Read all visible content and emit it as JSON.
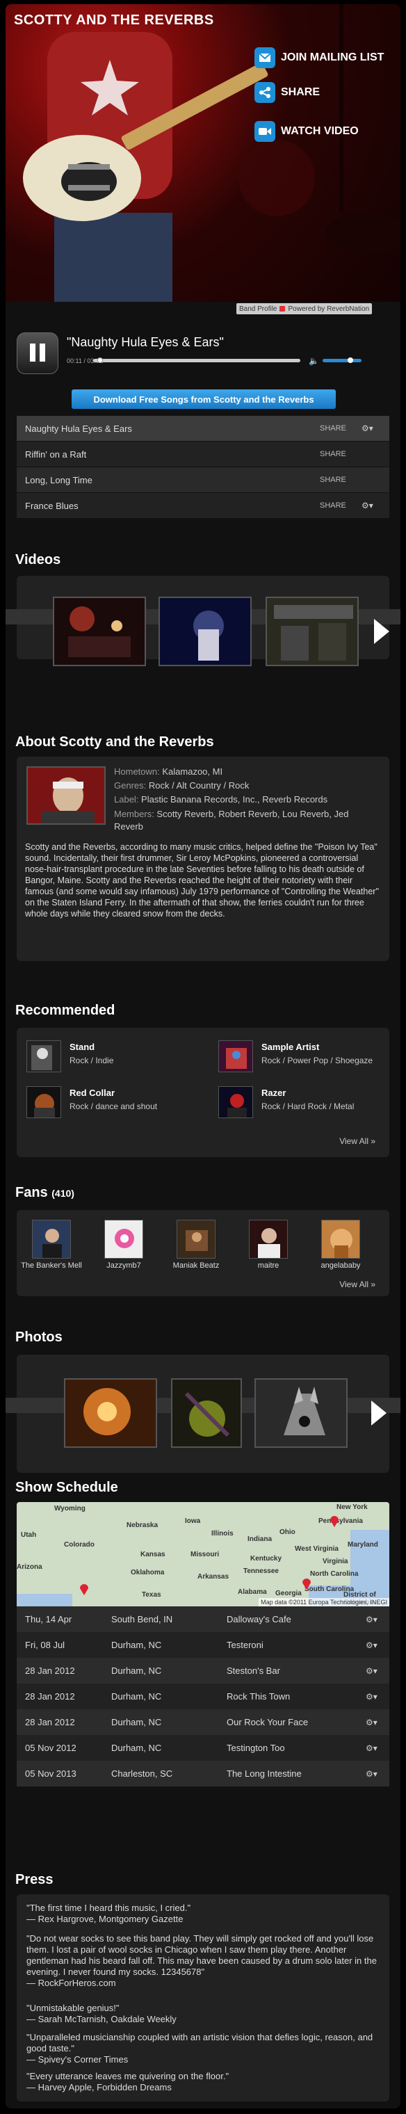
{
  "header": {
    "band_name": "SCOTTY AND THE REVERBS",
    "actions": [
      {
        "label": "JOIN MAILING LIST",
        "icon": "mail-icon"
      },
      {
        "label": "SHARE",
        "icon": "share-icon"
      },
      {
        "label": "WATCH VIDEO",
        "icon": "video-icon"
      }
    ],
    "credit": {
      "profile": "Band Profile",
      "powered": "Powered by ReverbNation"
    }
  },
  "player": {
    "now_playing": "\"Naughty Hula Eyes & Ears\"",
    "time": "00:11 / 03:02",
    "progress": 0.02,
    "volume": 0.75
  },
  "download_button": "Download Free Songs from Scotty and the Reverbs",
  "tracks": [
    {
      "title": "Naughty Hula Eyes & Ears",
      "share": "SHARE",
      "gear": "⚙▾"
    },
    {
      "title": "Riffin' on a Raft",
      "share": "SHARE",
      "gear": ""
    },
    {
      "title": "Long, Long Time",
      "share": "SHARE",
      "gear": ""
    },
    {
      "title": "France Blues",
      "share": "SHARE",
      "gear": "⚙▾"
    }
  ],
  "videos": {
    "heading": "Videos"
  },
  "about": {
    "heading": "About Scotty and the Reverbs",
    "hometown_label": "Hometown:",
    "hometown": "Kalamazoo, MI",
    "genres_label": "Genres:",
    "genres": "Rock / Alt Country / Rock",
    "label_label": "Label:",
    "label": "Plastic Banana Records, Inc., Reverb Records",
    "members_label": "Members:",
    "members": "Scotty Reverb, Robert Reverb, Lou Reverb, Jed Reverb",
    "bio": "Scotty and the Reverbs, according to many music critics, helped define the \"Poison Ivy Tea\" sound. Incidentally, their first drummer, Sir Leroy McPopkins, pioneered a controversial nose-hair-transplant procedure in the late Seventies before falling to his death outside of Bangor, Maine. Scotty and the Reverbs reached the height of their notoriety with their famous (and some would say infamous) July 1979 performance of \"Controlling the Weather\" on the Staten Island Ferry. In the aftermath of that show, the ferries couldn't run for three whole days while they cleared snow from the decks."
  },
  "recommended": {
    "heading": "Recommended",
    "items": [
      {
        "name": "Stand",
        "genre": "Rock / Indie"
      },
      {
        "name": "Sample Artist",
        "genre": "Rock / Power Pop / Shoegaze"
      },
      {
        "name": "Red Collar",
        "genre": "Rock / dance and shout"
      },
      {
        "name": "Razer",
        "genre": "Rock / Hard Rock / Metal"
      }
    ],
    "view_all": "View All »"
  },
  "fans": {
    "heading": "Fans",
    "count": "(410)",
    "items": [
      {
        "name": "The Banker's Mell"
      },
      {
        "name": "Jazzymb7"
      },
      {
        "name": "Maniak Beatz"
      },
      {
        "name": "maitre"
      },
      {
        "name": "angelababy"
      }
    ],
    "view_all": "View All »"
  },
  "photos": {
    "heading": "Photos"
  },
  "schedule": {
    "heading": "Show Schedule",
    "map_credit": "Map data ©2011 Europa Technologies, INEGI",
    "map_labels": [
      "Wyoming",
      "Nebraska",
      "Iowa",
      "Illinois",
      "Indiana",
      "Ohio",
      "Pennsylvania",
      "New York",
      "Utah",
      "Colorado",
      "Kansas",
      "Missouri",
      "Kentucky",
      "Virginia",
      "West Virginia",
      "Arizona",
      "Oklahoma",
      "Arkansas",
      "Tennessee",
      "North Carolina",
      "South Carolina",
      "Georgia",
      "Alabama",
      "Texas",
      "District of Columbia",
      "Maryland"
    ],
    "shows": [
      {
        "date": "Thu, 14 Apr",
        "city": "South Bend, IN",
        "venue": "Dalloway's Cafe"
      },
      {
        "date": "Fri, 08 Jul",
        "city": "Durham, NC",
        "venue": "Testeroni"
      },
      {
        "date": "28 Jan 2012",
        "city": "Durham, NC",
        "venue": "Steston's Bar"
      },
      {
        "date": "28 Jan 2012",
        "city": "Durham, NC",
        "venue": "Rock This Town"
      },
      {
        "date": "28 Jan 2012",
        "city": "Durham, NC",
        "venue": "Our Rock Your Face"
      },
      {
        "date": "05 Nov 2012",
        "city": "Durham, NC",
        "venue": "Testington Too"
      },
      {
        "date": "05 Nov 2013",
        "city": "Charleston, SC",
        "venue": "The Long Intestine"
      }
    ],
    "gear": "⚙▾"
  },
  "press": {
    "heading": "Press",
    "quotes": [
      {
        "text": "\"The first time I heard this music, I cried.\"",
        "by": "—  Rex Hargrove, Montgomery Gazette"
      },
      {
        "text": "\"Do not wear socks to see this band play. They will simply get rocked off and you'll lose them. I lost a pair of wool socks in Chicago when I saw them play there. Another gentleman had his beard fall off. This may have been caused by a drum solo later in the evening. I never found my socks. 12345678\"",
        "by": "—  RockForHeros.com"
      },
      {
        "text": "\"Unmistakable genius!\"",
        "by": "—  Sarah McTarnish, Oakdale Weekly"
      },
      {
        "text": "\"Unparalleled musicianship coupled with an artistic vision that defies logic, reason, and good taste.\"",
        "by": "—  Spivey's Corner Times"
      },
      {
        "text": "\"Every utterance leaves me quivering on the floor.\"",
        "by": "—  Harvey Apple, Forbidden Dreams"
      }
    ]
  }
}
